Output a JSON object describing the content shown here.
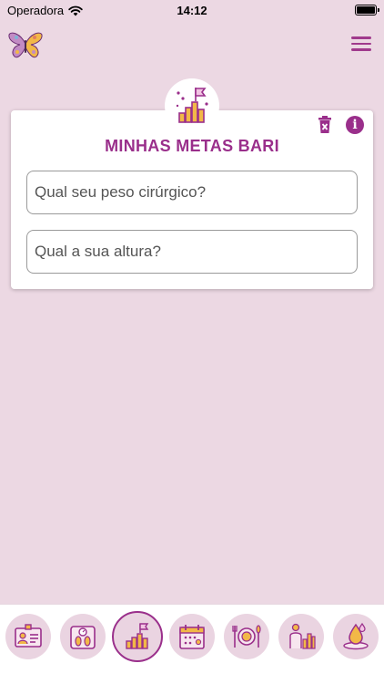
{
  "status_bar": {
    "carrier": "Operadora",
    "time": "14:12"
  },
  "header": {
    "logo_icon": "butterfly-icon",
    "menu_icon": "hamburger-menu-icon"
  },
  "card": {
    "badge_icon": "goal-bars-flag-icon",
    "title": "MINHAS METAS BARI",
    "actions": {
      "delete_icon": "trash-icon",
      "info_icon": "info-icon",
      "info_label": "i"
    },
    "weight_placeholder": "Qual seu peso cirúrgico?",
    "height_placeholder": "Qual a sua altura?"
  },
  "bottom_nav": {
    "items": [
      {
        "icon": "id-card-icon"
      },
      {
        "icon": "scale-icon"
      },
      {
        "icon": "goals-icon",
        "active": true
      },
      {
        "icon": "calendar-icon"
      },
      {
        "icon": "meal-icon"
      },
      {
        "icon": "progress-person-icon"
      },
      {
        "icon": "hydration-drop-icon"
      }
    ]
  },
  "colors": {
    "accent": "#9a2f8b",
    "background": "#ecd8e3",
    "nav_circle": "#ead4e1",
    "yellow": "#f2b847"
  }
}
